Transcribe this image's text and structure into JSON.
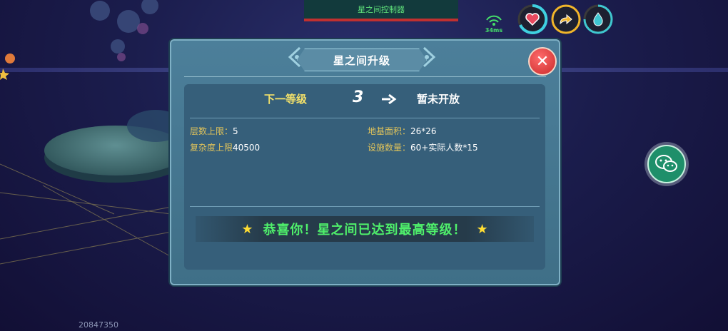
{
  "top_bar": {
    "label": "星之间控制器"
  },
  "hud": {
    "ping": "34ms",
    "health_color": "#e84a5f",
    "stamina_color": "#f0b52a",
    "water_color": "#3fc7d0"
  },
  "dialog": {
    "title": "星之间升级",
    "close_icon": "close-icon",
    "next_level_label": "下一等级",
    "current_level": "3",
    "next_level_value": "暂未开放",
    "stats": {
      "floors_key": "层数上限：",
      "floors_value": "5",
      "complexity_key": "复杂度上限",
      "complexity_value": "40500",
      "area_key": "地基面积：",
      "area_value": "26*26",
      "facilities_key": "设施数量：",
      "facilities_value": "60+实际人数*15"
    },
    "banner_message": "恭喜你！星之间已达到最高等级！"
  },
  "player_id": "20847350"
}
